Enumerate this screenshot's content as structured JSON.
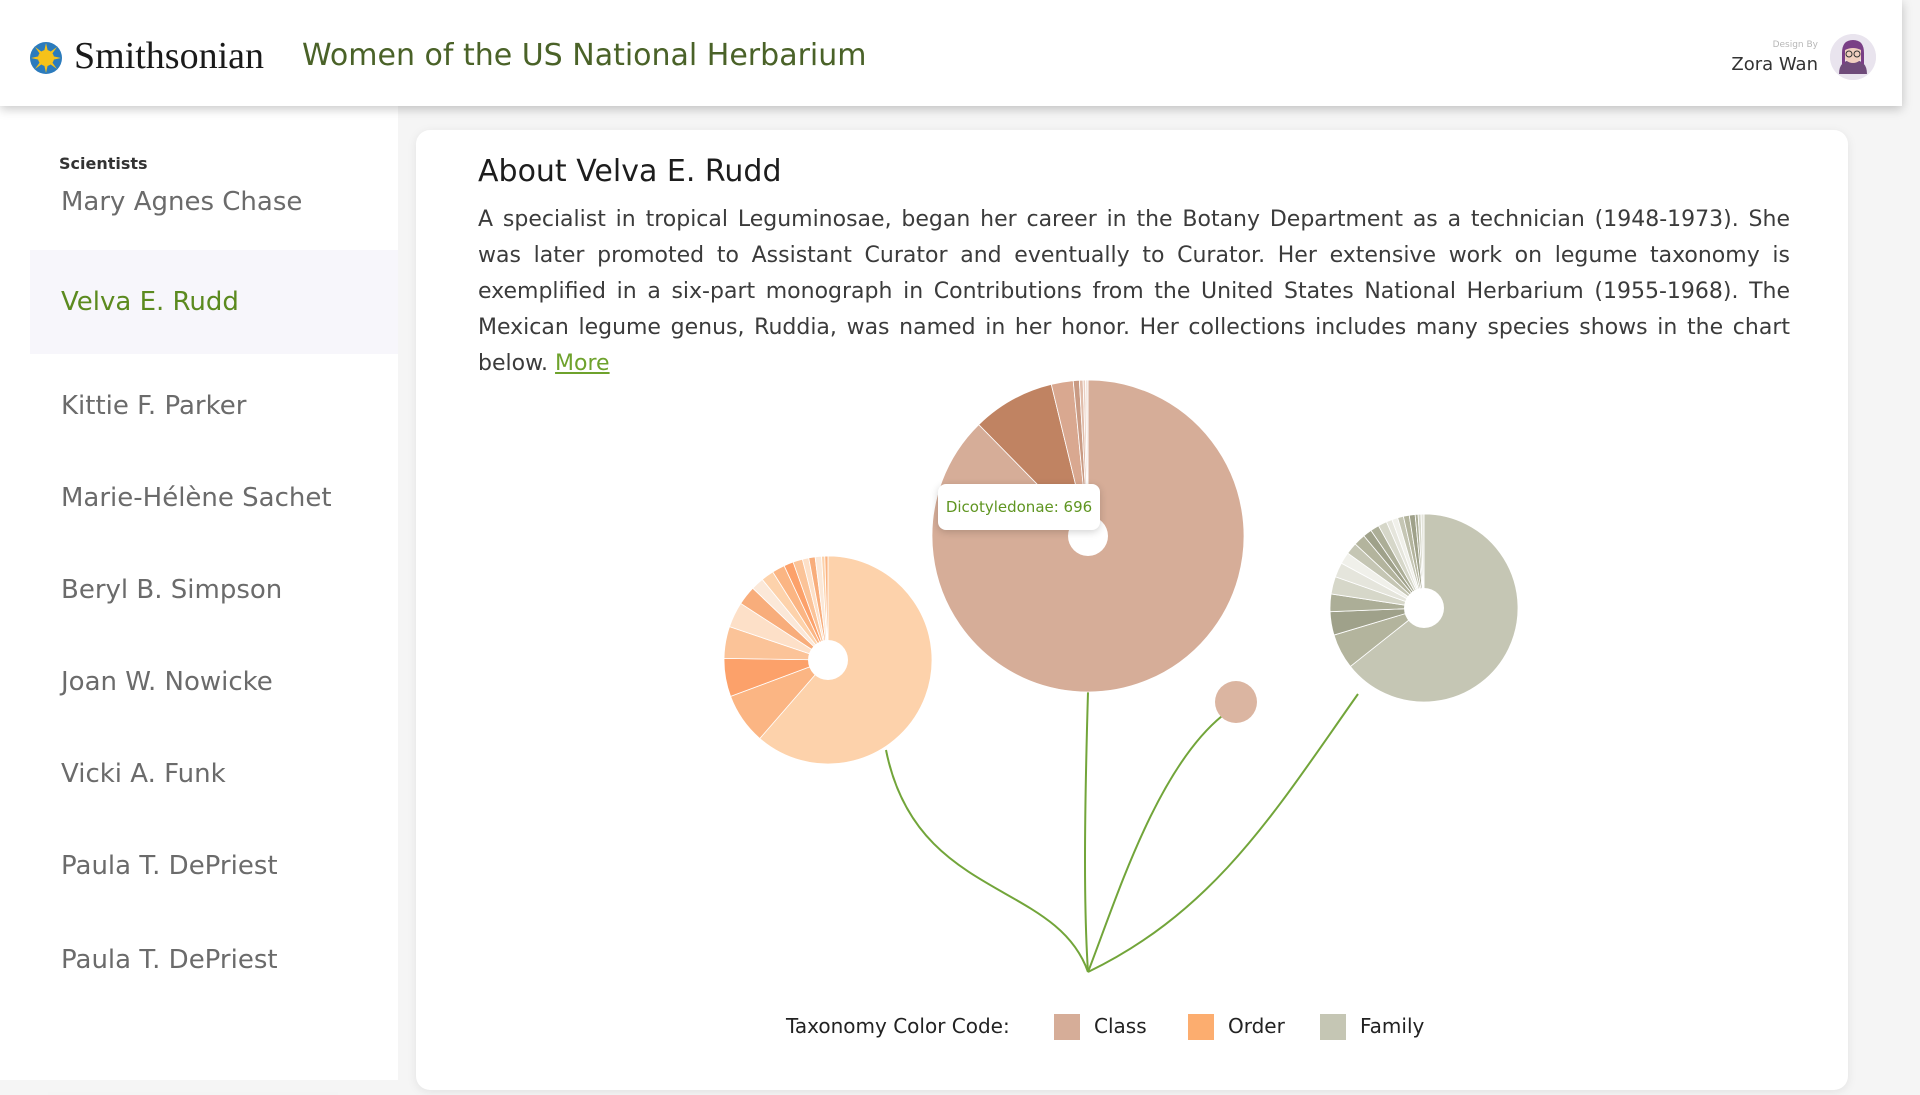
{
  "header": {
    "brand": "Smithsonian",
    "title": "Women of the US National Herbarium",
    "design_by_label": "Design By",
    "designer": "Zora Wan"
  },
  "sidebar": {
    "heading": "Scientists",
    "items": [
      {
        "label": "Mary Agnes Chase",
        "active": false
      },
      {
        "label": "Velva E. Rudd",
        "active": true
      },
      {
        "label": "Kittie F. Parker",
        "active": false
      },
      {
        "label": "Marie-Hélène Sachet",
        "active": false
      },
      {
        "label": "Beryl B. Simpson",
        "active": false
      },
      {
        "label": "Joan W. Nowicke",
        "active": false
      },
      {
        "label": "Vicki A. Funk",
        "active": false
      },
      {
        "label": "Paula T. DePriest",
        "active": false
      },
      {
        "label": "Paula T. DePriest",
        "active": false
      }
    ]
  },
  "about": {
    "title": "About Velva E. Rudd",
    "text": "A specialist in tropical Leguminosae, began her career in the Botany Department as a technician (1948-1973). She was later promoted to Assistant Curator and eventually to Curator. Her extensive work on legume taxonomy is exemplified in a six-part monograph in Contributions from the United States National Herbarium (1955-1968). The Mexican legume genus, Ruddia, was named in her honor. Her collections includes many species shows in the chart below.",
    "more_label": "More"
  },
  "tooltip": {
    "text": "Dicotyledonae: 696"
  },
  "legend": {
    "title": "Taxonomy Color Code:",
    "items": [
      {
        "label": "Class",
        "color": "#d6ad98"
      },
      {
        "label": "Order",
        "color": "#fcad6f"
      },
      {
        "label": "Family",
        "color": "#c5c6b4"
      }
    ]
  },
  "colors": {
    "accent_green": "#6ea22c",
    "title_green": "#4a6228",
    "stem_green": "#72a53a"
  },
  "chart_data": {
    "type": "pie",
    "title": "",
    "pies": [
      {
        "level": "Order",
        "slices": [
          {
            "label": "",
            "value": 62
          },
          {
            "label": "",
            "value": 8
          },
          {
            "label": "",
            "value": 6
          },
          {
            "label": "",
            "value": 5
          },
          {
            "label": "",
            "value": 4
          },
          {
            "label": "",
            "value": 3
          },
          {
            "label": "",
            "value": 2
          },
          {
            "label": "",
            "value": 2
          },
          {
            "label": "",
            "value": 2
          },
          {
            "label": "",
            "value": 1.5
          },
          {
            "label": "",
            "value": 1.5
          },
          {
            "label": "",
            "value": 1
          },
          {
            "label": "",
            "value": 1
          },
          {
            "label": "",
            "value": 1
          },
          {
            "label": "",
            "value": 0.5
          },
          {
            "label": "",
            "value": 0.5
          }
        ]
      },
      {
        "level": "Class",
        "slices": [
          {
            "label": "Dicotyledonae",
            "value": 696
          },
          {
            "label": "",
            "value": 68
          },
          {
            "label": "",
            "value": 18
          },
          {
            "label": "",
            "value": 5
          },
          {
            "label": "",
            "value": 3
          },
          {
            "label": "",
            "value": 2
          },
          {
            "label": "",
            "value": 2
          }
        ]
      },
      {
        "level": "Family",
        "slices": [
          {
            "label": "",
            "value": 64
          },
          {
            "label": "",
            "value": 6
          },
          {
            "label": "",
            "value": 4
          },
          {
            "label": "",
            "value": 3
          },
          {
            "label": "",
            "value": 3
          },
          {
            "label": "",
            "value": 2.5
          },
          {
            "label": "",
            "value": 2
          },
          {
            "label": "",
            "value": 2
          },
          {
            "label": "",
            "value": 2
          },
          {
            "label": "",
            "value": 1.5
          },
          {
            "label": "",
            "value": 1.5
          },
          {
            "label": "",
            "value": 1.5
          },
          {
            "label": "",
            "value": 1
          },
          {
            "label": "",
            "value": 1
          },
          {
            "label": "",
            "value": 1
          },
          {
            "label": "",
            "value": 1
          },
          {
            "label": "",
            "value": 1
          },
          {
            "label": "",
            "value": 0.5
          },
          {
            "label": "",
            "value": 0.5
          },
          {
            "label": "",
            "value": 0.5
          }
        ]
      },
      {
        "level": "Class",
        "slices": [
          {
            "label": "",
            "value": 1
          }
        ]
      }
    ]
  }
}
